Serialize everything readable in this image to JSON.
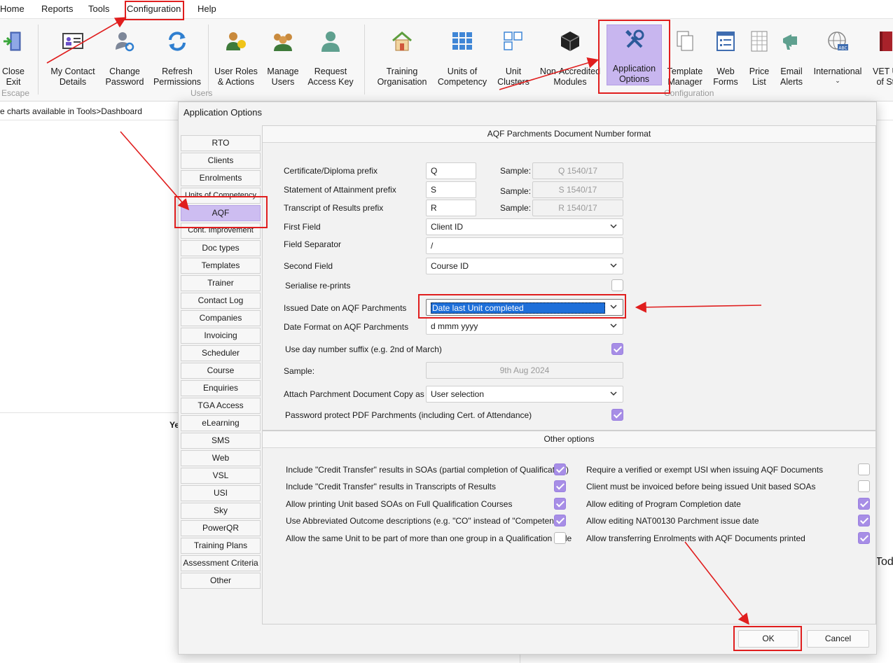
{
  "menu": [
    "Home",
    "Reports",
    "Tools",
    "Configuration",
    "Help"
  ],
  "ribbon": {
    "close_exit": "Close\nExit",
    "escape_label": "Escape",
    "my_contact": "My Contact\nDetails",
    "change_password": "Change\nPassword",
    "refresh_permissions": "Refresh\nPermissions",
    "user_roles": "User Roles\n& Actions",
    "manage_users": "Manage\nUsers",
    "request_access": "Request\nAccess Key",
    "users_group": "Users",
    "training_org": "Training\nOrganisation",
    "units_competency": "Units of\nCompetency",
    "unit_clusters": "Unit\nClusters",
    "non_accredited": "Non-Accredited\nModules",
    "application_options": "Application\nOptions",
    "template_manager": "Template\nManager",
    "web_forms": "Web\nForms",
    "price_list": "Price\nList",
    "email_alerts": "Email\nAlerts",
    "international": "International",
    "vet": "VET U\nof St",
    "configuration_group": "Configuration"
  },
  "background": {
    "breadcrumb_text": "e charts available in Tools>Dashboard",
    "partial_ye": "Ye",
    "partial_tod": "Tod"
  },
  "dialog": {
    "title": "Application Options",
    "sidebar": [
      "RTO",
      "Clients",
      "Enrolments",
      "Units of Competency",
      "AQF",
      "Cont. Improvement",
      "Doc types",
      "Templates",
      "Trainer",
      "Contact Log",
      "Companies",
      "Invoicing",
      "Scheduler",
      "Course",
      "Enquiries",
      "TGA Access",
      "eLearning",
      "SMS",
      "Web",
      "VSL",
      "USI",
      "Sky",
      "PowerQR",
      "Training Plans",
      "Assessment Criteria",
      "Other"
    ],
    "aqf_header": "AQF Parchments Document Number format",
    "cert_prefix_label": "Certificate/Diploma prefix",
    "cert_prefix_value": "Q",
    "soa_prefix_label": "Statement of Attainment prefix",
    "soa_prefix_value": "S",
    "transcript_prefix_label": "Transcript of Results prefix",
    "transcript_prefix_value": "R",
    "sample_label": "Sample:",
    "cert_sample": "Q 1540/17",
    "soa_sample": "S 1540/17",
    "transcript_sample": "R 1540/17",
    "first_field_label": "First Field",
    "first_field_value": "Client ID",
    "separator_label": "Field Separator",
    "separator_value": "/",
    "second_field_label": "Second Field",
    "second_field_value": "Course ID",
    "serialise_label": "Serialise re-prints",
    "issued_date_label": "Issued Date on AQF Parchments",
    "issued_date_value": "Date last Unit completed",
    "date_format_label": "Date Format on AQF Parchments",
    "date_format_value": "d mmm yyyy",
    "day_suffix_label": "Use day number suffix (e.g. 2nd of March)",
    "sample_plain_label": "Sample:",
    "date_sample": "9th Aug 2024",
    "attach_copy_label": "Attach Parchment Document Copy as",
    "attach_copy_value": "User selection",
    "password_protect_label": "Password protect PDF Parchments (including Cert. of Attendance)",
    "other_header": "Other options",
    "left_options": [
      "Include \"Credit Transfer\" results in SOAs (partial completion of Qualification)",
      "Include \"Credit Transfer\" results in Transcripts of Results",
      "Allow printing Unit based SOAs on Full Qualification Courses",
      "Use Abbreviated Outcome descriptions (e.g. \"CO\" instead of \"Competent\")",
      "Allow the same Unit to be part of more than one group in a Qualification Rule"
    ],
    "right_options": [
      "Require a verified or exempt USI when issuing AQF Documents",
      "Client must be invoiced before being issued Unit based SOAs",
      "Allow editing of Program Completion date",
      "Allow editing NAT00130 Parchment issue date",
      "Allow transferring Enrolments with AQF Documents printed"
    ],
    "ok": "OK",
    "cancel": "Cancel"
  },
  "states": {
    "serialise": false,
    "day_suffix": true,
    "password_protect": true,
    "left_checked": [
      true,
      true,
      true,
      true,
      false
    ],
    "right_checked": [
      false,
      false,
      true,
      true,
      true
    ]
  },
  "colors": {
    "accent": "#a78ee6",
    "selection": "#1e6fd9",
    "annotation": "#e01e1e"
  }
}
